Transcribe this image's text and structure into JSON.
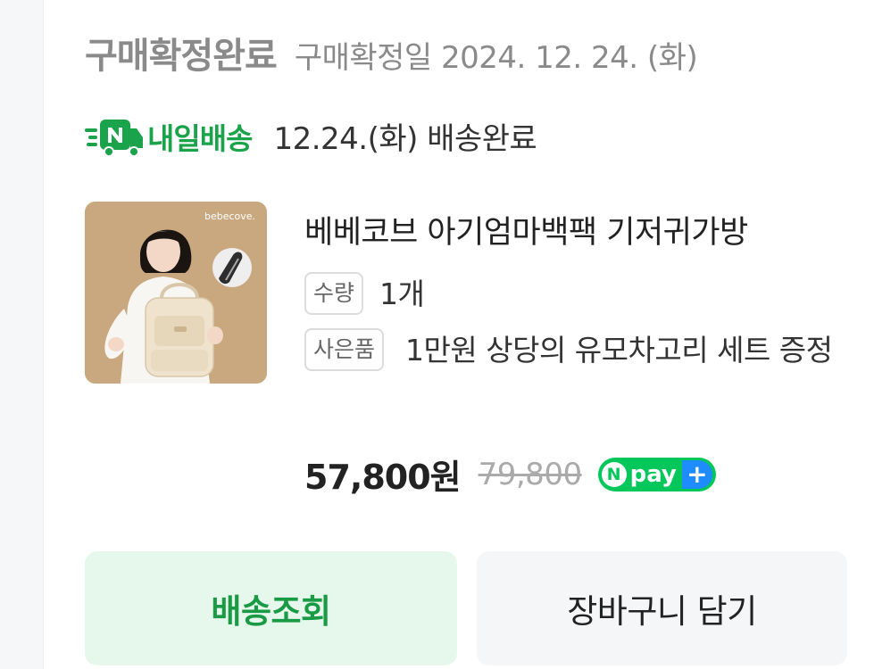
{
  "order": {
    "status": "구매확정완료",
    "confirm_date": "구매확정일 2024. 12. 24. (화)"
  },
  "delivery": {
    "badge_label": "내일배송",
    "badge_icon": "n-truck-icon",
    "badge_color": "#1aa34a",
    "status_text": "12.24.(화) 배송완료"
  },
  "product": {
    "brand_logo_text": "bebecove.",
    "name": "베베코브 아기엄마백팩 기저귀가방",
    "quantity_label": "수량",
    "quantity_value": "1개",
    "gift_label": "사은품",
    "gift_value": "1만원 상당의 유모차고리 세트 증정",
    "price_sale": "57,800원",
    "price_original": "79,800",
    "pay_badge": {
      "n_letter": "N",
      "text": "pay",
      "plus": "+"
    }
  },
  "actions": {
    "track_label": "배송조회",
    "cart_label": "장바구니 담기"
  },
  "colors": {
    "accent_green": "#1aa34a",
    "track_button_bg": "#e6f8ec",
    "cart_button_bg": "#f5f6f8",
    "npay_green": "#03c75a",
    "npay_blue": "#1e8cff"
  }
}
